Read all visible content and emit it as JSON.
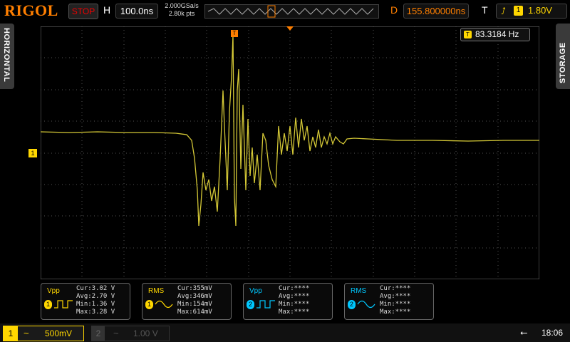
{
  "top": {
    "brand": "RIGOL",
    "run_status": "STOP",
    "h_label": "H",
    "timebase": "100.0ns",
    "sample_rate": "2.000GSa/s",
    "memory_depth": "2.80k pts",
    "d_label": "D",
    "delay": "155.800000ns",
    "t_label": "T",
    "trigger_edge_icon": "rising-edge-icon",
    "trigger_channel": "1",
    "trigger_level": "1.80V"
  },
  "side": {
    "left_tab": "HORIZONTAL",
    "right_tab": "STORAGE"
  },
  "screen": {
    "freq_channel": "T",
    "frequency": "83.3184 Hz",
    "trig_marker": "T",
    "ch1_ground_marker": "1"
  },
  "measurements": [
    {
      "title": "Vpp",
      "channel": "1",
      "color": "#ffd700",
      "cur": "Cur:3.02 V",
      "avg": "Avg:2.70 V",
      "min": "Min:1.36 V",
      "max": "Max:3.28 V"
    },
    {
      "title": "RMS",
      "channel": "1",
      "color": "#ffd700",
      "cur": "Cur:355mV",
      "avg": "Avg:346mV",
      "min": "Min:154mV",
      "max": "Max:614mV"
    },
    {
      "title": "Vpp",
      "channel": "2",
      "color": "#00c8ff",
      "cur": "Cur:****",
      "avg": "Avg:****",
      "min": "Min:****",
      "max": "Max:****"
    },
    {
      "title": "RMS",
      "channel": "2",
      "color": "#00c8ff",
      "cur": "Cur:****",
      "avg": "Avg:****",
      "min": "Min:****",
      "max": "Max:****"
    }
  ],
  "bottom": {
    "ch1": {
      "num": "1",
      "coupling": "~",
      "scale": "500mV"
    },
    "ch2": {
      "num": "2",
      "coupling": "~",
      "scale": "1.00 V"
    },
    "usb_icon": "usb-icon",
    "time": "18:06"
  },
  "colors": {
    "ch1": "#ffd700",
    "ch2": "#00c8ff",
    "trigger": "#ff7f00",
    "stop": "#ee0000"
  }
}
